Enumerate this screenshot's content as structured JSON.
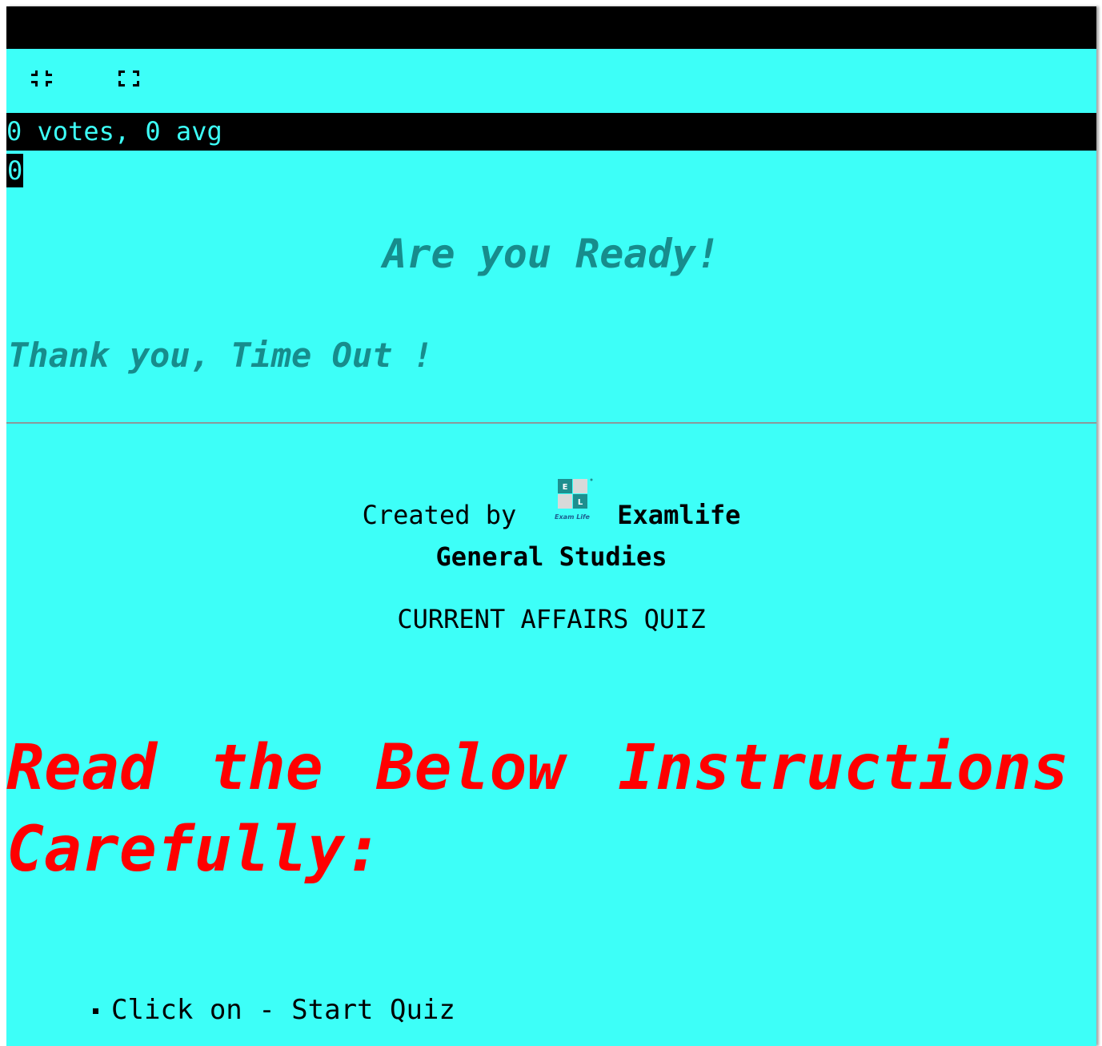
{
  "votes": {
    "summary": "0 votes, 0 avg",
    "count": "0"
  },
  "quiz": {
    "ready_text": "Are you Ready!",
    "timeout_text": "Thank you, Time Out !",
    "created_by_label": "Created by",
    "brand": "Examlife",
    "subject": "General Studies",
    "title": "CURRENT AFFAIRS QUIZ"
  },
  "instructions": {
    "heading": "Read the Below Instructions Carefully:",
    "steps": [
      "Click on - Start Quiz"
    ]
  },
  "toolbar": {
    "exit_fullscreen_icon": "exit-fullscreen-icon",
    "fullscreen_icon": "fullscreen-icon"
  },
  "logo": {
    "letter_top": "E",
    "letter_bottom": "L",
    "wordmark": "Exam Life"
  },
  "colors": {
    "background": "#3dfff8",
    "bar": "#000000",
    "teal_text": "#178c8c",
    "instruction_red": "#ff0000"
  }
}
